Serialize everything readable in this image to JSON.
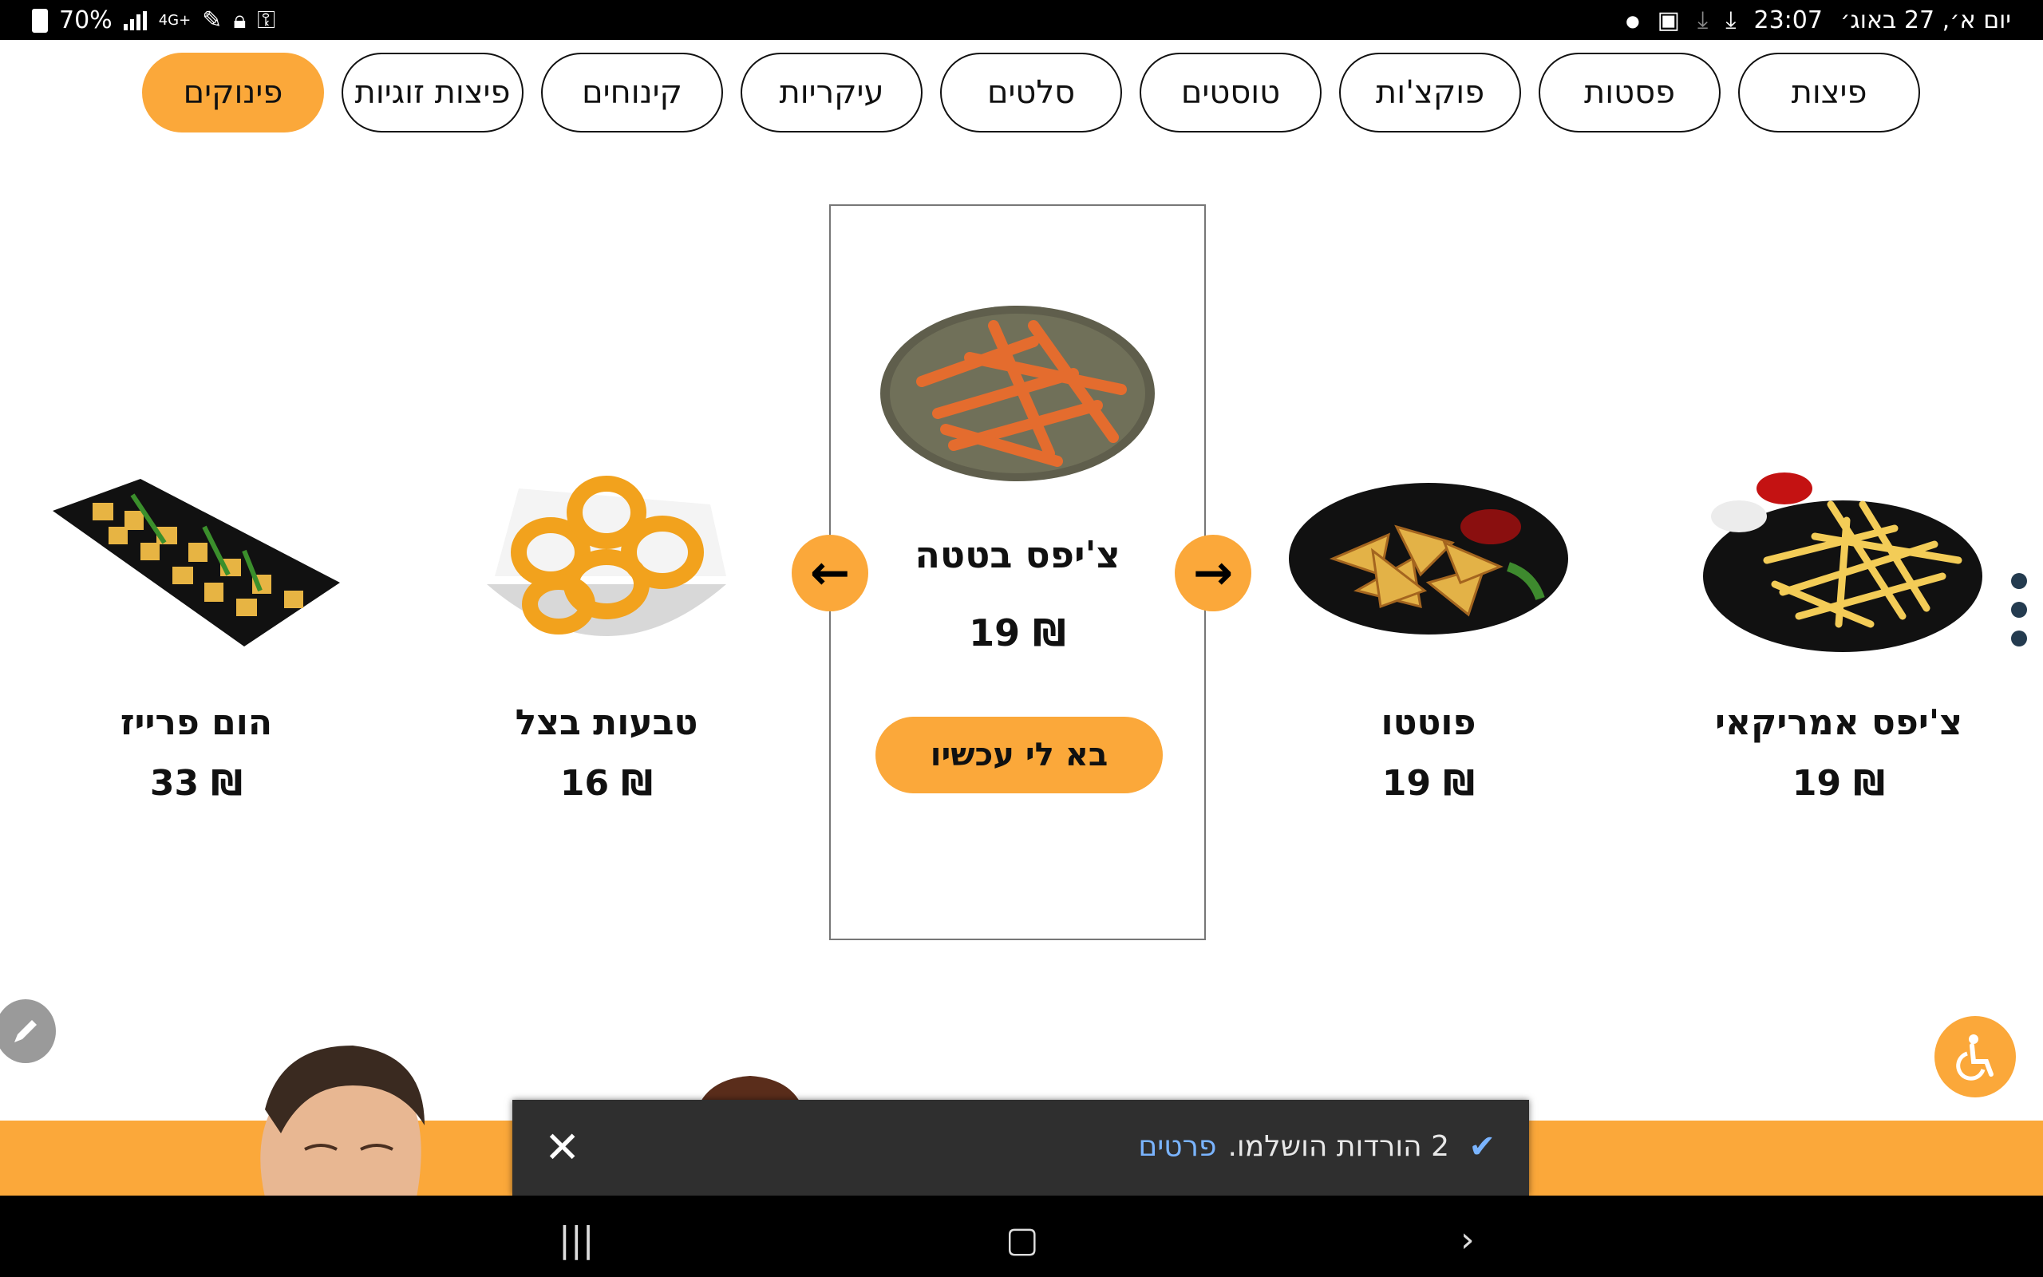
{
  "status": {
    "battery": "70%",
    "network": "4G+",
    "time": "23:07",
    "date": "יום א׳, 27 באוג׳"
  },
  "categories": [
    {
      "label": "פיצות",
      "active": false
    },
    {
      "label": "פסטות",
      "active": false
    },
    {
      "label": "פוקצ'ות",
      "active": false
    },
    {
      "label": "טוסטים",
      "active": false
    },
    {
      "label": "סלטים",
      "active": false
    },
    {
      "label": "עיקריות",
      "active": false
    },
    {
      "label": "קינוחים",
      "active": false
    },
    {
      "label": "פיצות זוגיות",
      "active": false
    },
    {
      "label": "פינוקים",
      "active": true
    }
  ],
  "products": [
    {
      "name": "צ'יפס אמריקאי",
      "price": "19 ₪",
      "image": "french-fries-plate"
    },
    {
      "name": "פוטטו",
      "price": "19 ₪",
      "image": "potato-wedges-plate"
    },
    {
      "name": "טבעות בצל",
      "price": "16 ₪",
      "image": "onion-rings-bowl"
    },
    {
      "name": "הום פרייז",
      "price": "33 ₪",
      "image": "home-fries-plate"
    }
  ],
  "featured": {
    "name": "צ'יפס בטטה",
    "price": "19 ₪",
    "order_label": "בא לי עכשיו",
    "image": "sweet-potato-fries-plate"
  },
  "snackbar": {
    "message": "2 הורדות הושלמו.",
    "link": "פרטים",
    "close": "✕"
  },
  "colors": {
    "accent": "#fba83a",
    "snackbar_bg": "#2f2f2f",
    "link": "#7ab4ff"
  }
}
